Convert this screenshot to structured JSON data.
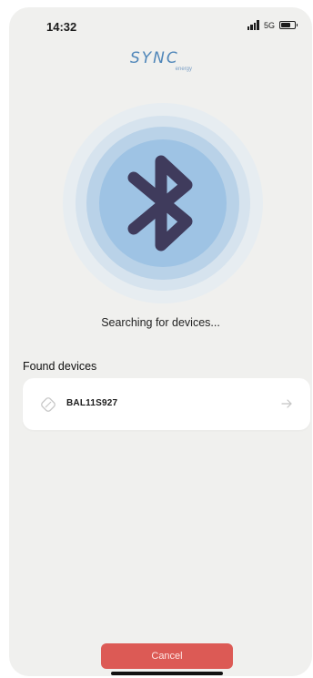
{
  "status_bar": {
    "time": "14:32",
    "network": "5G"
  },
  "logo": {
    "name": "SYNC",
    "sub": "energy",
    "color": "#4f86b9"
  },
  "scan": {
    "icon": "bluetooth-icon",
    "status_text": "Searching for devices..."
  },
  "found": {
    "title": "Found devices",
    "devices": [
      {
        "name": "BAL11S927",
        "icon": "device-icon",
        "action_icon": "arrow-right-icon"
      }
    ]
  },
  "actions": {
    "cancel_label": "Cancel",
    "cancel_color": "#dc5a55"
  }
}
